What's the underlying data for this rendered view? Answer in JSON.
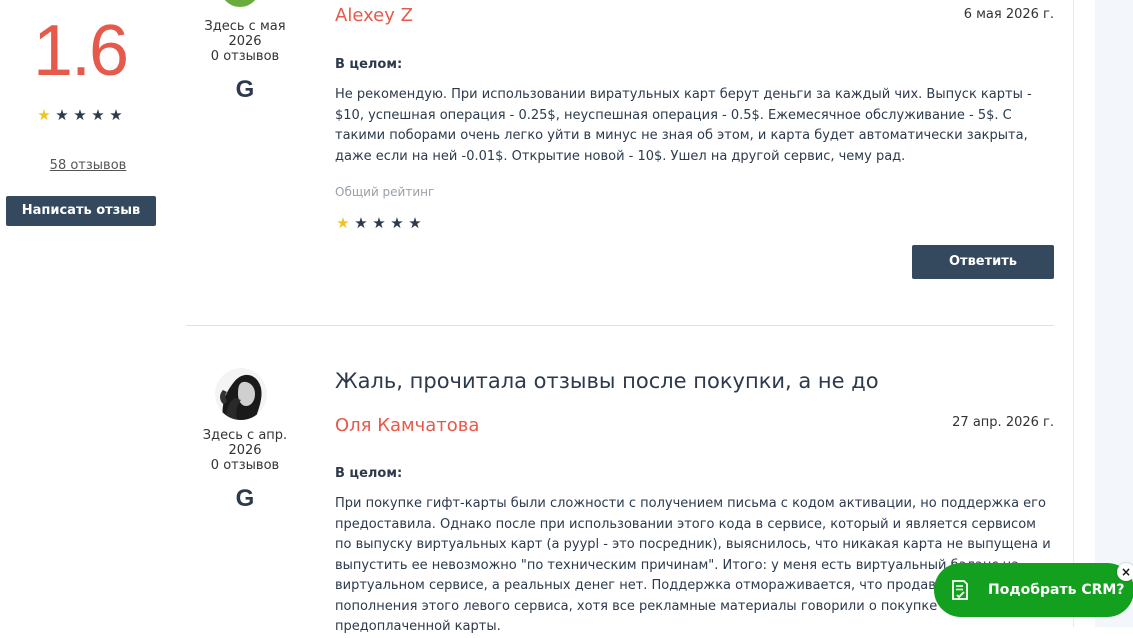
{
  "summary": {
    "score": "1.6",
    "rating_stars": 1,
    "reviews_link": "58 отзывов",
    "write_button": "Написать отзыв"
  },
  "reviews": [
    {
      "member_since": "Здесь с мая 2026",
      "reviews_count": "0 отзывов",
      "source_icon": "google-g-icon",
      "author": "Alexey Z",
      "date": "6 мая 2026 г.",
      "section_label": "В целом:",
      "text": "Не рекомендую. При использовании виратульных карт берут деньги за каждый чих. Выпуск карты - $10, успешная операция - 0.25$, неуспешная операция - 0.5$. Ежемесячное обслуживание - 5$. С такими поборами очень легко уйти в минус не зная об этом, и карта будет автоматически закрыта, даже если на ней -0.01$. Открытие новой - 10$. Ушел на другой сервис, чему рад.",
      "rating_label": "Общий рейтинг",
      "rating_stars": 1,
      "reply_button": "Ответить"
    },
    {
      "member_since": "Здесь с апр. 2026",
      "reviews_count": "0 отзывов",
      "source_icon": "google-g-icon",
      "title": "Жаль, прочитала отзывы после покупки, а не до",
      "author": "Оля Камчатова",
      "date": "27 апр. 2026 г.",
      "section_label": "В целом:",
      "text": "При покупке гифт-карты были сложности с получением письма с кодом активации, но поддержка его предоставила. Однако после при использовании этого кода в сервисе, который и является сервисом по выпуску виртуальных карт (а pyypl - это посредник), выяснилось, что никакая карта не выпущена и выпустить ее невозможно \"по техническим причинам\". Итого: у меня есть виртуальный баланс на виртуальном сервисе, а реальных денег нет. Поддержка отмораживается, что продавали метод пополнения этого левого сервиса, хотя все рекламные материалы говорили о покупке предоплаченной карты."
    }
  ],
  "crm_widget": {
    "label": "Подобрать CRM?",
    "close": "×"
  },
  "colors": {
    "accent_red": "#e55a4a",
    "dark_navy": "#34495e",
    "star_gold": "#f3c21f",
    "crm_green": "#14a01f"
  }
}
